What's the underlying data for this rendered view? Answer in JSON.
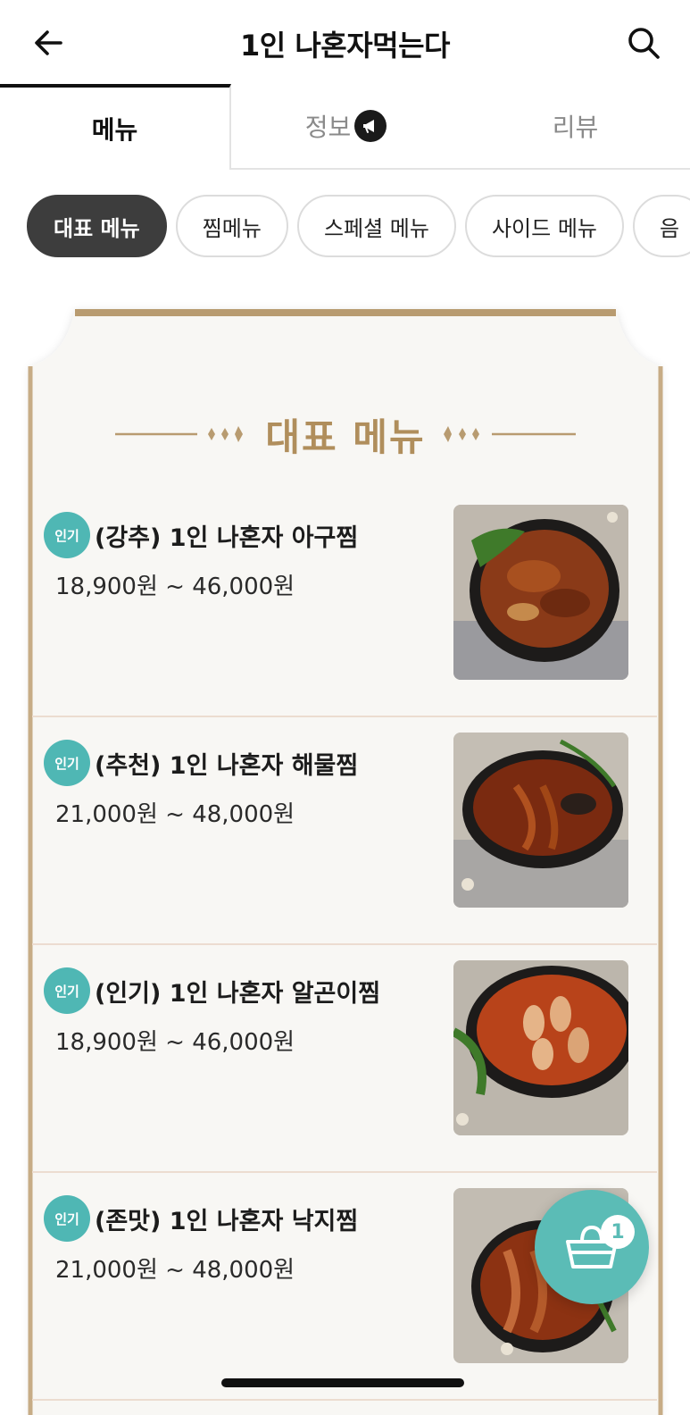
{
  "header": {
    "title": "1인 나혼자먹는다",
    "back_icon": "arrow-left-icon",
    "search_icon": "search-icon"
  },
  "tabs": [
    {
      "label": "메뉴",
      "active": true
    },
    {
      "label": "정보",
      "active": false,
      "icon": "megaphone-icon"
    },
    {
      "label": "리뷰",
      "active": false
    }
  ],
  "categories": [
    {
      "label": "대표 메뉴",
      "active": true
    },
    {
      "label": "찜메뉴",
      "active": false
    },
    {
      "label": "스페셜 메뉴",
      "active": false
    },
    {
      "label": "사이드 메뉴",
      "active": false
    },
    {
      "label": "음",
      "active": false
    }
  ],
  "section": {
    "title": "대표 메뉴"
  },
  "menu_items": [
    {
      "badge": "인기",
      "name": "(강추) 1인 나혼자 아구찜",
      "price": "18,900원 ~ 46,000원"
    },
    {
      "badge": "인기",
      "name": "(추천) 1인 나혼자 해물찜",
      "price": "21,000원 ~ 48,000원"
    },
    {
      "badge": "인기",
      "name": "(인기) 1인 나혼자 알곤이찜",
      "price": "18,900원 ~ 46,000원"
    },
    {
      "badge": "인기",
      "name": "(존맛) 1인 나혼자 낙지찜",
      "price": "21,000원 ~ 48,000원"
    }
  ],
  "cart": {
    "count": "1",
    "icon": "shopping-basket-icon"
  },
  "colors": {
    "accent_teal": "#5bbcb6",
    "badge_teal": "#4fb7b4",
    "gold": "#b08e5c",
    "chip_active": "#3d3d3d"
  }
}
